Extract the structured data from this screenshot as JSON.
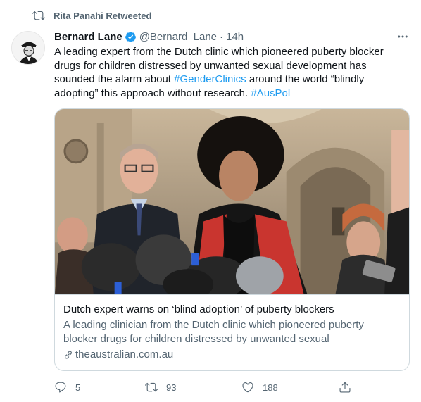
{
  "retweet": {
    "icon": "retweet-icon",
    "text": "Rita Panahi Retweeted"
  },
  "author": {
    "name": "Bernard Lane",
    "verified_icon": "verified-badge-icon",
    "handle": "@Bernard_Lane",
    "separator": "·",
    "time": "14h"
  },
  "tweet": {
    "text_1": "A leading expert from the Dutch clinic which pioneered puberty blocker drugs for children distressed by unwanted sexual development has sounded the alarm about ",
    "hashtag_1": "#GenderClinics",
    "text_2": " around the world “blindly adopting” this approach without research. ",
    "hashtag_2": "#AusPol"
  },
  "card": {
    "title": "Dutch expert warns on ‘blind adoption’ of puberty blockers",
    "description": "A leading clinician from the Dutch clinic which pioneered puberty blocker drugs for children distressed by unwanted sexual development…",
    "domain": "theaustralian.com.au",
    "link_icon": "link-icon"
  },
  "actions": {
    "reply_count": "5",
    "retweet_count": "93",
    "like_count": "188"
  },
  "colors": {
    "accent": "#1d9bf0",
    "secondary_text": "#536471",
    "border": "#cfd9de"
  }
}
